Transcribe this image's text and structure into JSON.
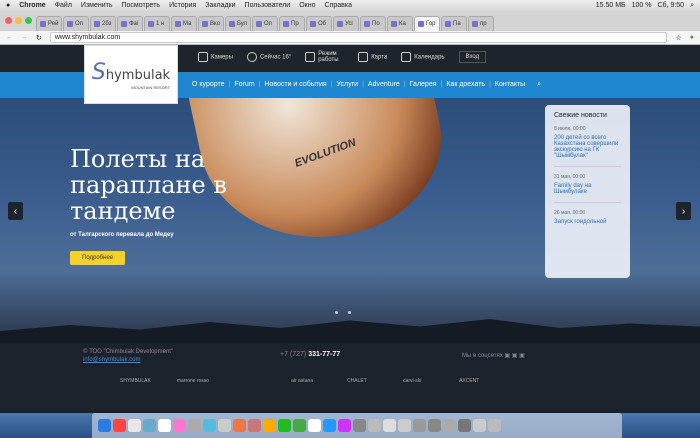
{
  "menubar": {
    "app": "Chrome",
    "items": [
      "Файл",
      "Изменить",
      "Посмотреть",
      "История",
      "Закладки",
      "Пользователи",
      "Окно",
      "Справка"
    ],
    "status": "15.50 МБ",
    "battery": "100 %",
    "clock": "Сб, 9:50"
  },
  "tabs": [
    "Рей",
    "Оп",
    "2бз",
    "Фаі",
    "1 н",
    "Ма",
    "Вко",
    "Бул",
    "Оп",
    "Пр",
    "Об",
    "Усі",
    "По",
    "Ка",
    "Гор",
    "Па",
    "пр"
  ],
  "active_tab": 14,
  "address": "www.shymbulak.com",
  "logo": {
    "text": "Shymbulak",
    "tagline": "MOUNTAIN RESORT"
  },
  "topbar": {
    "cameras": "Камеры",
    "weather": "Сейчас 16°",
    "hours": "Режим работы",
    "map": "Карта",
    "calendar": "Календарь",
    "login": "Вход"
  },
  "nav": [
    "О курорте",
    "Forum",
    "Новости и события",
    "Услуги",
    "Adventure",
    "Галерея",
    "Как доехать",
    "Контакты"
  ],
  "hero": {
    "title": "Полеты на параплане в тандеме",
    "subtitle": "от Талгарского перевала до Медеу",
    "button": "Подробнее",
    "wing_text": "EVOLUTION"
  },
  "news": {
    "title": "Свежие новости",
    "items": [
      {
        "date": "8 июля, 00:00",
        "text": "200 детей со всего Казахстана совершили экскурсию на ГК \"Шымбулак\""
      },
      {
        "date": "31 мая, 00:00",
        "text": "Family day на Шымбулаке"
      },
      {
        "date": "26 мая, 00:00",
        "text": "Запуск гондольной"
      }
    ]
  },
  "footer": {
    "company": "© ТОО \"Chimbulak Development\"",
    "email": "info@shymbulak.com",
    "phone_prefix": "+7 (727)",
    "phone": "331-77-77",
    "social": "Мы в соцсетях",
    "partners": [
      "SHYMBULAK",
      "marrone rosso",
      "",
      "air astana",
      "CHALET",
      "carvi-ski",
      "AXCENT"
    ]
  }
}
